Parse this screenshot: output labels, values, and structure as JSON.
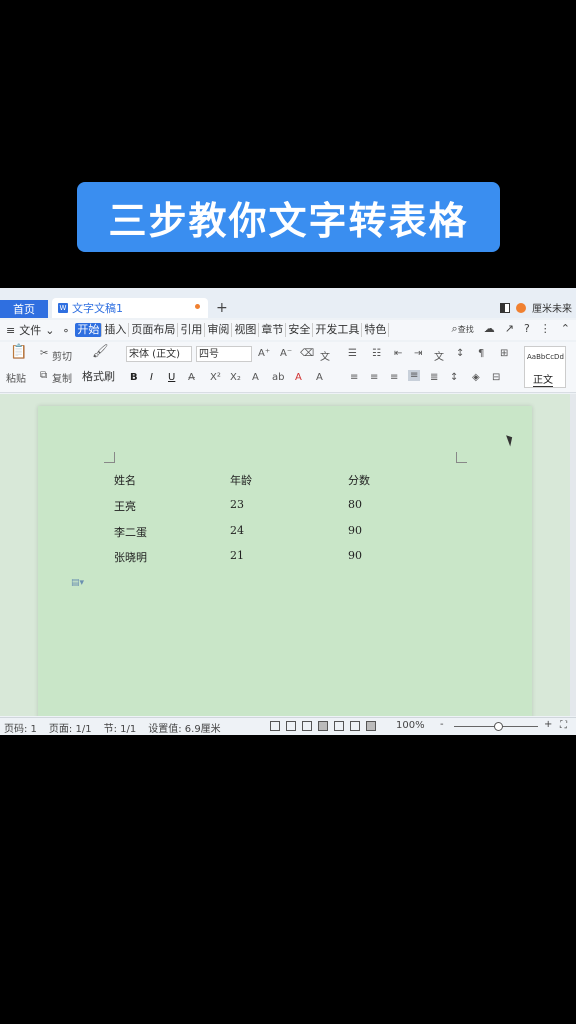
{
  "banner": {
    "title": "三步教你文字转表格"
  },
  "tabs": {
    "home": "首页",
    "doc_title": "文字文稿1",
    "plus": "+",
    "user": "厘米未来"
  },
  "menu": {
    "file": "文件",
    "items": [
      "开始",
      "插入",
      "页面布局",
      "引用",
      "审阅",
      "视图",
      "章节",
      "安全",
      "开发工具",
      "特色"
    ],
    "search": "查找",
    "help": "?"
  },
  "ribbon": {
    "paste": "粘贴",
    "cut": "剪切",
    "copy": "复制",
    "format_painter": "格式刷",
    "font": "宋体 (正文)",
    "size": "四号",
    "bold": "B",
    "italic": "I",
    "underline": "U",
    "style_sample": "AaBbCcDd",
    "style_name": "正文"
  },
  "document": {
    "rows": [
      [
        "姓名",
        "年龄",
        "分数"
      ],
      [
        "王亮",
        "23",
        "80"
      ],
      [
        "李二蛋",
        "24",
        "90"
      ],
      [
        "张晓明",
        "21",
        "90"
      ]
    ]
  },
  "status": {
    "page_num": "页码: 1",
    "pages": "页面: 1/1",
    "section": "节: 1/1",
    "setting": "设置值: 6.9厘米",
    "zoom": "100%",
    "minus": "-",
    "plus": "+"
  }
}
